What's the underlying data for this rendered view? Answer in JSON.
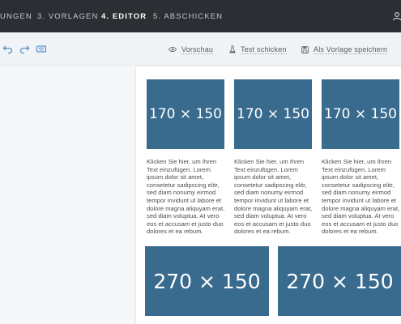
{
  "nav": {
    "steps": [
      {
        "label": "UNGEN",
        "active": false
      },
      {
        "label": "3. VORLAGEN",
        "active": false
      },
      {
        "label": "4. EDITOR",
        "active": true
      },
      {
        "label": "5. ABSCHICKEN",
        "active": false
      }
    ],
    "account_icon": "person-icon"
  },
  "toolbar": {
    "tools": [
      "undo-icon",
      "redo-icon",
      "keyboard-icon"
    ],
    "preview_label": "Vorschau",
    "test_label": "Test schicken",
    "save_label": "Als Vorlage speichern"
  },
  "colors": {
    "nav_bg": "#2b2e33",
    "toolbar_bg": "#f1f4f7",
    "placeholder": "#396b8f",
    "icon_blue": "#5b8fc7"
  },
  "content": {
    "columns": [
      {
        "image": "170 × 150",
        "text": "Klicken Sie hier, um Ihren Text einzufügen. Lorem ipsum dolor sit amet, consetetur sadipscing elitr, sed diam nonumy eirmod tempor invidunt ut labore et dolore magna aliquyam erat, sed diam voluptua. At vero eos et accusam et justo duo dolores et ea rebum."
      },
      {
        "image": "170 × 150",
        "text": "Klicken Sie hier, um Ihren Text einzufügen. Lorem ipsum dolor sit amet, consetetur sadipscing elitr, sed diam nonumy eirmod tempor invidunt ut labore et dolore magna aliquyam erat, sed diam voluptua. At vero eos et accusam et justo duo dolores et ea rebum."
      },
      {
        "image": "170 × 150",
        "text": "Klicken Sie hier, um Ihren Text einzufügen. Lorem ipsum dolor sit amet, consetetur sadipscing elitr, sed diam nonumy eirmod tempor invidunt ut labore et dolore magna aliquyam erat, sed diam voluptua. At vero eos et accusam et justo duo dolores et ea rebum."
      }
    ],
    "wide_images": [
      "270 × 150",
      "270 × 150"
    ]
  }
}
